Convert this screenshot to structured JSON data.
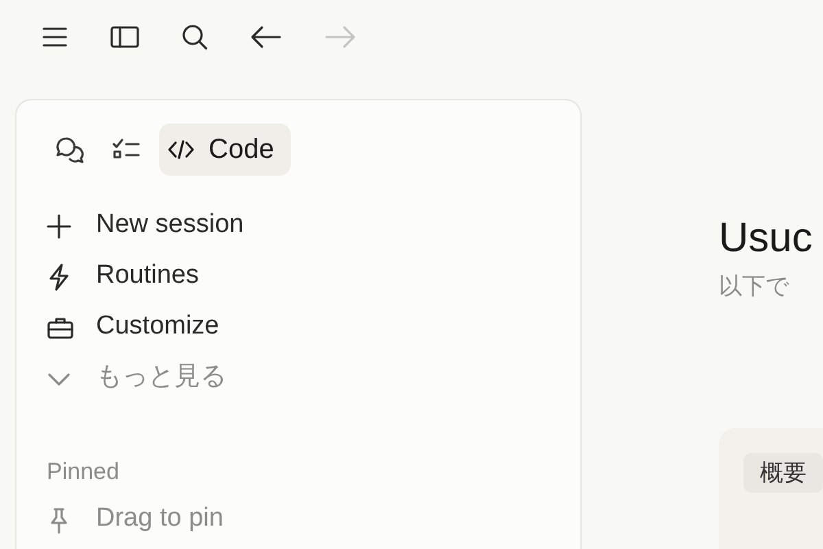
{
  "toolbar": {
    "buttons": [
      {
        "kind": "menu",
        "disabled": false
      },
      {
        "kind": "sidebar",
        "disabled": false
      },
      {
        "kind": "search",
        "disabled": false
      },
      {
        "kind": "back",
        "disabled": false
      },
      {
        "kind": "forward",
        "disabled": true
      }
    ]
  },
  "sidebar": {
    "modes": [
      {
        "kind": "chat",
        "selected": false
      },
      {
        "kind": "tasks",
        "selected": false
      },
      {
        "kind": "code",
        "label": "Code",
        "selected": true
      }
    ],
    "items": [
      {
        "kind": "plus",
        "label": "New session",
        "muted": false
      },
      {
        "kind": "bolt",
        "label": "Routines",
        "muted": false
      },
      {
        "kind": "briefcase",
        "label": "Customize",
        "muted": false
      },
      {
        "kind": "chevron",
        "label": "もっと見る",
        "muted": true
      }
    ],
    "section": "Pinned",
    "pinned": [
      {
        "kind": "pin",
        "label": "Drag to pin"
      }
    ]
  },
  "main": {
    "title": "Usuc",
    "subtitle": "以下で",
    "card": {
      "tag": "概要"
    }
  }
}
